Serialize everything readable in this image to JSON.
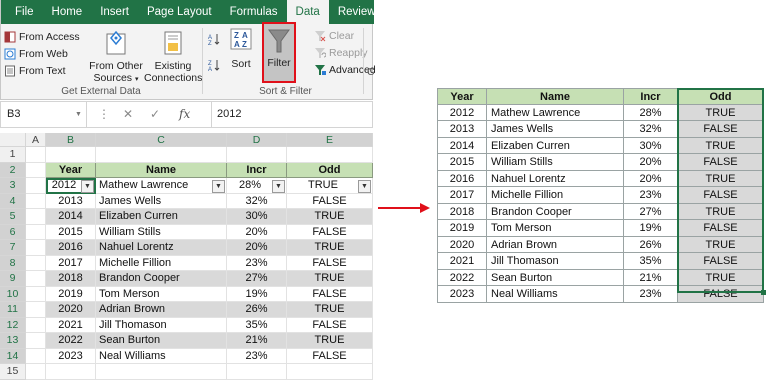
{
  "ribbon": {
    "tabs": [
      "File",
      "Home",
      "Insert",
      "Page Layout",
      "Formulas",
      "Data",
      "Review"
    ],
    "active_tab": "Data",
    "get_external_data": {
      "label": "Get External Data",
      "from_access": "From Access",
      "from_web": "From Web",
      "from_text": "From Text",
      "from_other_line1": "From Other",
      "from_other_line2": "Sources",
      "existing_line1": "Existing",
      "existing_line2": "Connections"
    },
    "sort_filter": {
      "label": "Sort & Filter",
      "sort": "Sort",
      "filter": "Filter",
      "clear": "Clear",
      "reapply": "Reapply",
      "advanced": "Advanced"
    },
    "cutoff_letter": "C"
  },
  "formula_bar": {
    "name_box": "B3",
    "fx": "fx",
    "value": "2012"
  },
  "sheet": {
    "columns": [
      "A",
      "B",
      "C",
      "D",
      "E"
    ],
    "row_numbers": [
      "1",
      "2",
      "3",
      "4",
      "5",
      "6",
      "7",
      "8",
      "9",
      "10",
      "11",
      "12",
      "13",
      "14",
      "15"
    ],
    "headers": [
      "Year",
      "Name",
      "Incr",
      "Odd"
    ],
    "rows": [
      [
        "2012",
        "Mathew Lawrence",
        "28%",
        "TRUE"
      ],
      [
        "2013",
        "James Wells",
        "32%",
        "FALSE"
      ],
      [
        "2014",
        "Elizaben Curren",
        "30%",
        "TRUE"
      ],
      [
        "2015",
        "William Stills",
        "20%",
        "FALSE"
      ],
      [
        "2016",
        "Nahuel Lorentz",
        "20%",
        "TRUE"
      ],
      [
        "2017",
        "Michelle Fillion",
        "23%",
        "FALSE"
      ],
      [
        "2018",
        "Brandon Cooper",
        "27%",
        "TRUE"
      ],
      [
        "2019",
        "Tom Merson",
        "19%",
        "FALSE"
      ],
      [
        "2020",
        "Adrian Brown",
        "26%",
        "TRUE"
      ],
      [
        "2021",
        "Jill Thomason",
        "35%",
        "FALSE"
      ],
      [
        "2022",
        "Sean Burton",
        "21%",
        "TRUE"
      ],
      [
        "2023",
        "Neal Williams",
        "23%",
        "FALSE"
      ]
    ]
  },
  "result": {
    "headers": [
      "Year",
      "Name",
      "Incr",
      "Odd"
    ],
    "rows": [
      [
        "2012",
        "Mathew Lawrence",
        "28%",
        "TRUE"
      ],
      [
        "2013",
        "James Wells",
        "32%",
        "FALSE"
      ],
      [
        "2014",
        "Elizaben Curren",
        "30%",
        "TRUE"
      ],
      [
        "2015",
        "William Stills",
        "20%",
        "FALSE"
      ],
      [
        "2016",
        "Nahuel Lorentz",
        "20%",
        "TRUE"
      ],
      [
        "2017",
        "Michelle Fillion",
        "23%",
        "FALSE"
      ],
      [
        "2018",
        "Brandon Cooper",
        "27%",
        "TRUE"
      ],
      [
        "2019",
        "Tom Merson",
        "19%",
        "FALSE"
      ],
      [
        "2020",
        "Adrian Brown",
        "26%",
        "TRUE"
      ],
      [
        "2021",
        "Jill Thomason",
        "35%",
        "FALSE"
      ],
      [
        "2022",
        "Sean Burton",
        "21%",
        "TRUE"
      ],
      [
        "2023",
        "Neal Williams",
        "23%",
        "FALSE"
      ]
    ]
  },
  "colors": {
    "excel_green": "#217346",
    "header_fill": "#c6e0b4",
    "band_fill": "#d9d9d9",
    "highlight_red": "#e0101a"
  },
  "icons": {
    "filter": "funnel-icon",
    "sort": "sort-icon",
    "arrow": "right-arrow-icon"
  }
}
